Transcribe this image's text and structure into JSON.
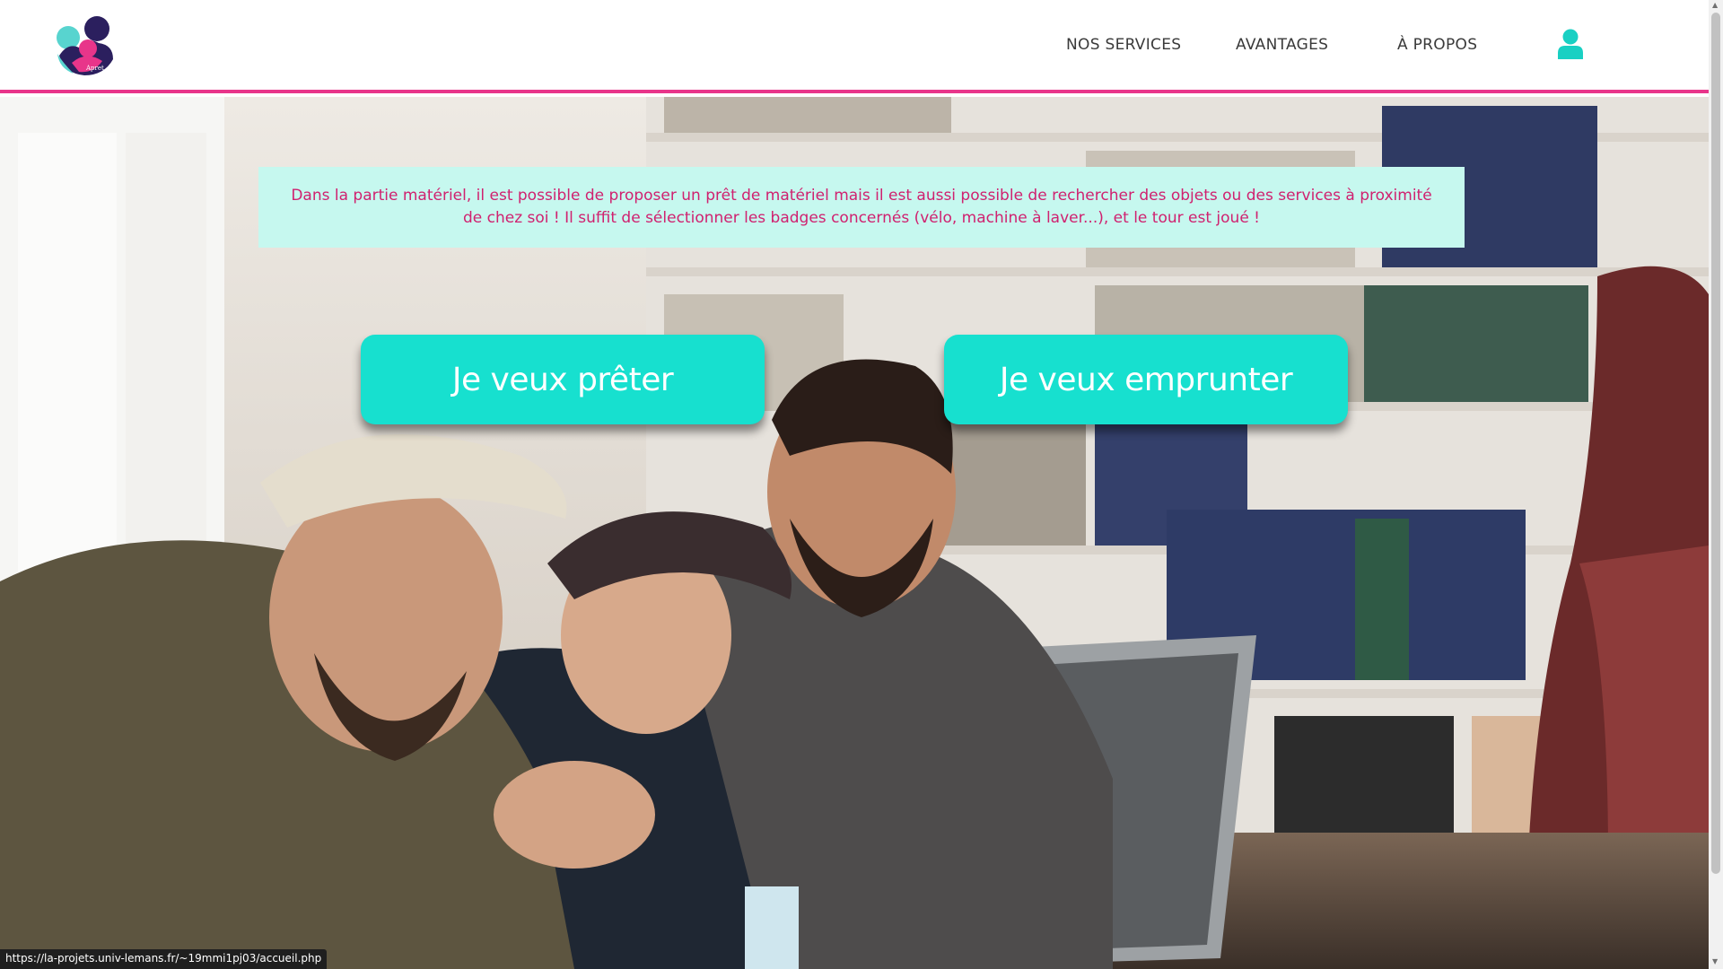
{
  "header": {
    "logo_name": "logo",
    "nav": [
      {
        "label": "NOS SERVICES"
      },
      {
        "label": "AVANTAGES"
      },
      {
        "label": "À PROPOS"
      }
    ],
    "user_icon": "user-icon"
  },
  "hero": {
    "info_text": "Dans la partie matériel, il est possible de proposer un prêt de matériel mais il est aussi possible de rechercher des objets ou des services à proximité de chez soi ! Il suffit de sélectionner les badges concernés (vélo, machine à laver...), et le tour est joué !",
    "buttons": {
      "lend": "Je veux prêter",
      "borrow": "Je veux emprunter"
    }
  },
  "status_bar": {
    "url": "https://la-projets.univ-lemans.fr/~19mmi1pj03/accueil.php"
  },
  "colors": {
    "accent_pink": "#e8358a",
    "accent_teal": "#17e0cf",
    "info_bg": "#c6f8ef",
    "info_text": "#d0216f",
    "user_icon": "#19d0c3"
  }
}
